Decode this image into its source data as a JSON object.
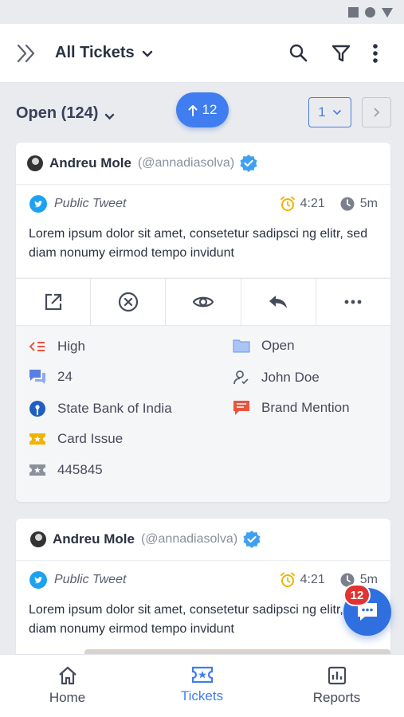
{
  "header": {
    "title": "All Tickets"
  },
  "subbar": {
    "open_label": "Open (124)",
    "new_count": "12",
    "page": "1"
  },
  "tickets": [
    {
      "author": "Andreu Mole",
      "handle": "(@annadiasolva)",
      "type": "Public Tweet",
      "time": "4:21",
      "age": "5m",
      "text": "Lorem ipsum dolor sit amet, consetetur sadipsci ng elitr, sed diam nonumy eirmod tempo invidunt",
      "priority": "High",
      "status": "Open",
      "messages": "24",
      "assignee": "John Doe",
      "account": "State Bank of India",
      "channel": "Brand Mention",
      "category": "Card Issue",
      "ticket_id": "445845"
    },
    {
      "author": "Andreu Mole",
      "handle": "(@annadiasolva)",
      "type": "Public Tweet",
      "time": "4:21",
      "age": "5m",
      "text": "Lorem ipsum dolor sit amet, consetetur sadipsci ng elitr, sed diam nonumy eirmod tempo invidunt"
    }
  ],
  "fab": {
    "badge": "12"
  },
  "nav": [
    {
      "label": "Home",
      "icon": "home-icon"
    },
    {
      "label": "Tickets",
      "icon": "ticket-icon"
    },
    {
      "label": "Reports",
      "icon": "reports-icon"
    }
  ],
  "colors": {
    "accent": "#3f7df0",
    "badge": "#e23232",
    "twitter": "#1da1f2",
    "priority": "#e8553e",
    "alarm": "#f0b400"
  }
}
